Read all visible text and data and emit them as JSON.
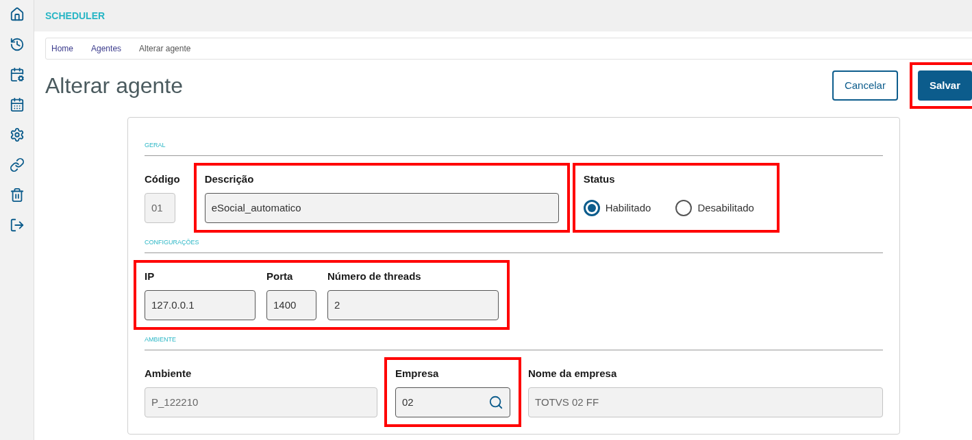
{
  "header": {
    "title": "SCHEDULER"
  },
  "breadcrumb": [
    {
      "label": "Home",
      "current": false
    },
    {
      "label": "Agentes",
      "current": false
    },
    {
      "label": "Alterar agente",
      "current": true
    }
  ],
  "page": {
    "title": "Alterar agente"
  },
  "actions": [
    {
      "label": "Cancelar",
      "kind": "secondary",
      "highlighted": false
    },
    {
      "label": "Salvar",
      "kind": "primary",
      "highlighted": true
    }
  ],
  "form": {
    "sections": [
      {
        "title": "GERAL",
        "groups": [
          {
            "highlighted": false,
            "fields": [
              {
                "kind": "text",
                "label": "Código",
                "value": "01"
              }
            ]
          },
          {
            "highlighted": true,
            "fields": [
              {
                "kind": "text",
                "label": "Descrição",
                "value": "eSocial_automatico"
              }
            ]
          },
          {
            "highlighted": true,
            "fields": [
              {
                "kind": "radio",
                "label": "Status",
                "options": [
                  {
                    "label": "Habilitado",
                    "selected": true
                  },
                  {
                    "label": "Desabilitado",
                    "selected": false
                  }
                ]
              }
            ]
          }
        ]
      },
      {
        "title": "CONFIGURAÇÕES",
        "groups": [
          {
            "highlighted": true,
            "fields": [
              {
                "kind": "text",
                "label": "IP",
                "value": "127.0.0.1"
              },
              {
                "kind": "text",
                "label": "Porta",
                "value": "1400"
              },
              {
                "kind": "text",
                "label": "Número de threads",
                "value": "2"
              }
            ]
          }
        ]
      },
      {
        "title": "AMBIENTE",
        "groups": [
          {
            "highlighted": false,
            "fields": [
              {
                "kind": "text",
                "label": "Ambiente",
                "value": "P_122210"
              }
            ]
          },
          {
            "highlighted": true,
            "fields": [
              {
                "kind": "lookup",
                "label": "Empresa",
                "value": "02"
              }
            ]
          },
          {
            "highlighted": false,
            "fields": [
              {
                "kind": "text",
                "label": "Nome da empresa",
                "value": "TOTVS 02 FF"
              }
            ]
          }
        ]
      }
    ]
  }
}
